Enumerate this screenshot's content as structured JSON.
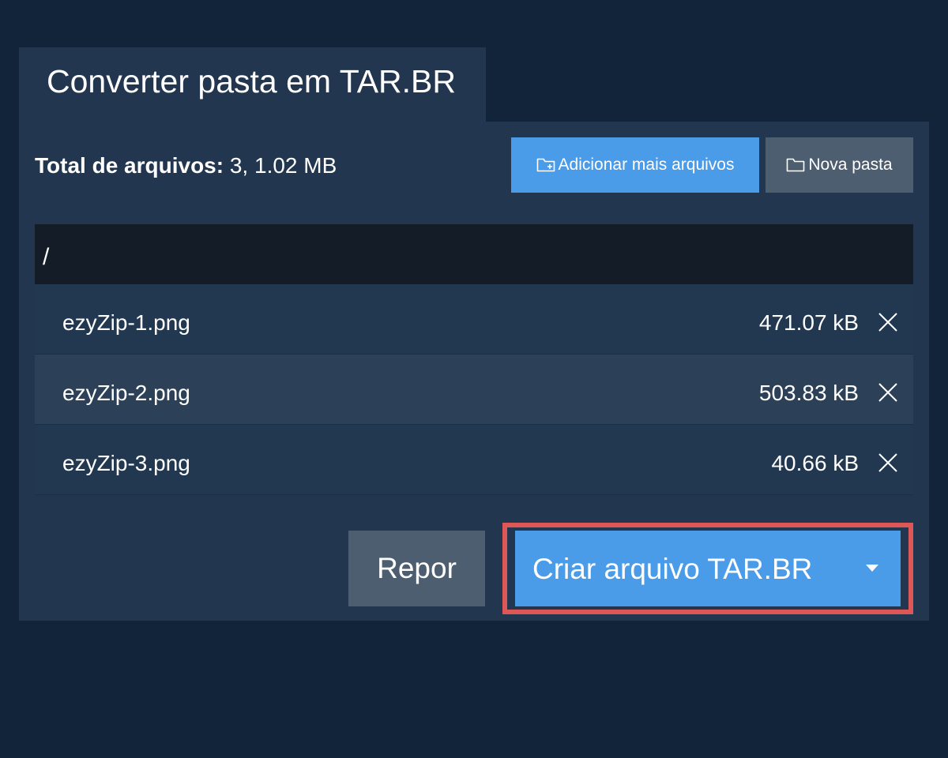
{
  "header": {
    "title": "Converter pasta em TAR.BR"
  },
  "summary": {
    "label": "Total de arquivos:",
    "value": "3, 1.02 MB"
  },
  "toolbar": {
    "add_files_label": "Adicionar mais arquivos",
    "new_folder_label": "Nova pasta",
    "add_files_icon": "folder-plus-icon",
    "new_folder_icon": "folder-icon"
  },
  "path": "/",
  "files": [
    {
      "name": "ezyZip-1.png",
      "size": "471.07 kB"
    },
    {
      "name": "ezyZip-2.png",
      "size": "503.83 kB"
    },
    {
      "name": "ezyZip-3.png",
      "size": "40.66 kB"
    }
  ],
  "actions": {
    "reset_label": "Repor",
    "create_label": "Criar arquivo TAR.BR"
  },
  "colors": {
    "background": "#12243a",
    "panel": "#223650",
    "primary": "#4a9be8",
    "secondary": "#4d5e70",
    "highlight": "#de5757"
  }
}
